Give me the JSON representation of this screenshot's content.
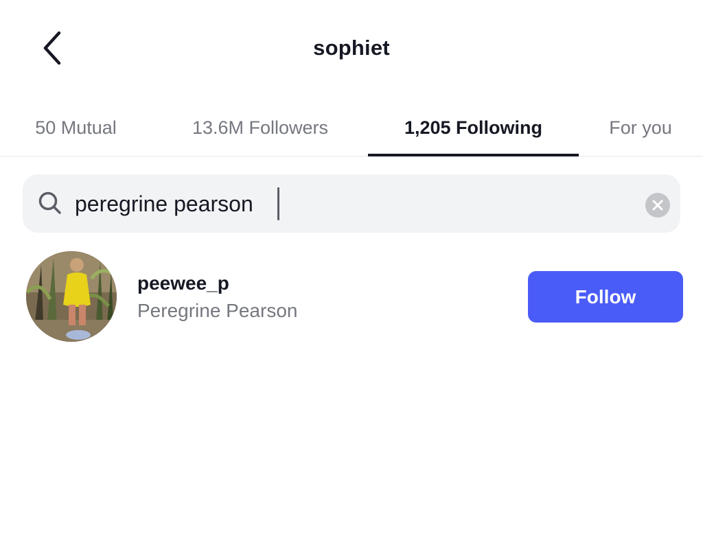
{
  "header": {
    "back_icon": "chevron-left-icon",
    "title": "sophiet"
  },
  "tabs": [
    {
      "label": "50 Mutual",
      "active": false
    },
    {
      "label": "13.6M Followers",
      "active": false
    },
    {
      "label": "1,205 Following",
      "active": true
    },
    {
      "label": "For you",
      "active": false
    }
  ],
  "search": {
    "icon": "search-icon",
    "value": "peregrine pearson",
    "clear_icon": "clear-icon"
  },
  "results": [
    {
      "username": "peewee_p",
      "full_name": "Peregrine Pearson",
      "follow_label": "Follow",
      "avatar": "user-avatar-photo"
    }
  ],
  "colors": {
    "text_primary": "#161823",
    "text_secondary": "#75777f",
    "follow_button": "#4a5cf7",
    "search_background": "#f2f3f5"
  }
}
